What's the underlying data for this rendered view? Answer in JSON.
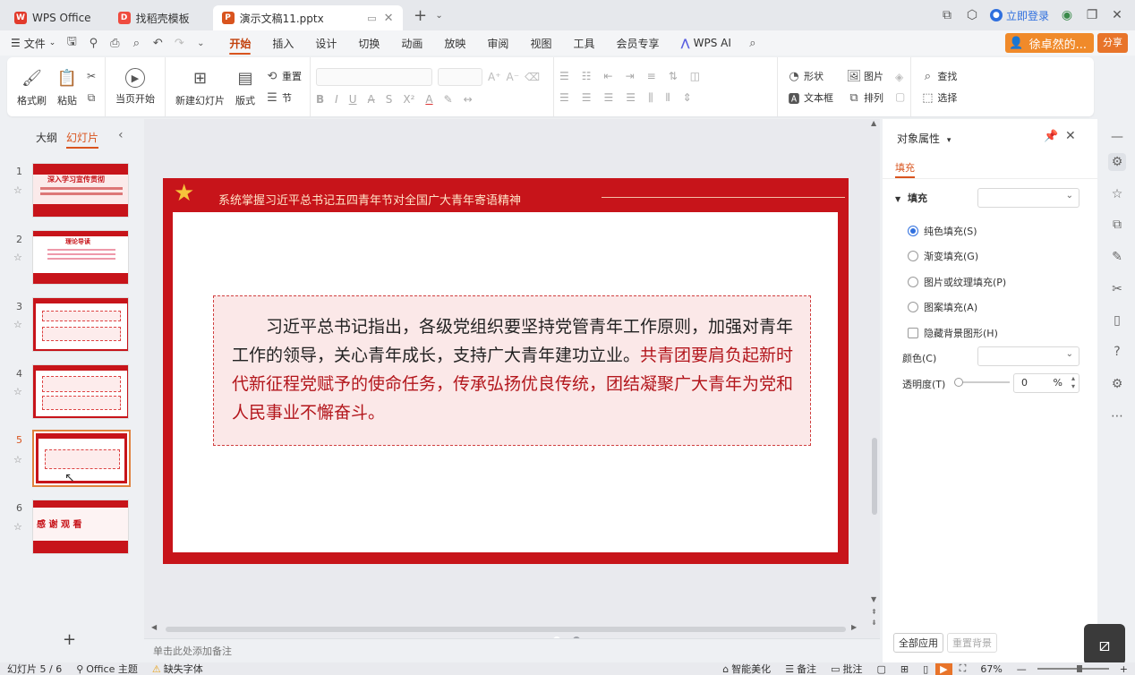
{
  "titlebar": {
    "tabs": [
      {
        "label": "WPS Office",
        "icon": "wps-logo-icon"
      },
      {
        "label": "找稻壳模板",
        "icon": "docer-icon"
      },
      {
        "label": "演示文稿11.pptx",
        "icon": "ppt-file-icon"
      }
    ],
    "login_label": "立即登录",
    "user_name": "徐卓然的..."
  },
  "menubar": {
    "file_label": "文件",
    "items": [
      "开始",
      "插入",
      "设计",
      "切换",
      "动画",
      "放映",
      "审阅",
      "视图",
      "工具",
      "会员专享"
    ],
    "active_item": "开始",
    "wps_ai_label": "WPS AI",
    "share_label": "分享"
  },
  "ribbon": {
    "format_painter": "格式刷",
    "paste": "粘贴",
    "from_current": "当页开始",
    "new_slide": "新建幻灯片",
    "layout": "版式",
    "reset": "重置",
    "section": "节",
    "shape": "形状",
    "picture": "图片",
    "textbox": "文本框",
    "arrange": "排列",
    "find": "查找",
    "select": "选择"
  },
  "leftpane": {
    "tab_outline": "大纲",
    "tab_slides": "幻灯片",
    "numbers": [
      "1",
      "2",
      "3",
      "4",
      "5",
      "6"
    ],
    "selected_index": 5,
    "thumb1_title": "深入学习宣传贯彻",
    "thumb2_title": "理论导读",
    "thumb6_title": "感 谢 观 看"
  },
  "slide": {
    "header_title": "系统掌握习近平总书记五四青年节对全国广大青年寄语精神",
    "body_black": "习近平总书记指出，各级党组织要坚持党管青年工作原则，加强对青年工作的领导，关心青年成长，支持广大青年建功立业。",
    "body_red": "共青团要肩负起新时代新征程党赋予的使命任务，传承弘扬优良传统，团结凝聚广大青年为党和人民事业不懈奋斗。"
  },
  "notes_placeholder": "单击此处添加备注",
  "rightpane": {
    "title": "对象属性",
    "tab_fill": "填充",
    "section_fill": "填充",
    "options": [
      "纯色填充(S)",
      "渐变填充(G)",
      "图片或纹理填充(P)",
      "图案填充(A)"
    ],
    "selected_option": "纯色填充(S)",
    "hide_bg_label": "隐藏背景图形(H)",
    "color_label": "颜色(C)",
    "transparency_label": "透明度(T)",
    "transparency_value": "0",
    "transparency_unit": "%",
    "apply_all": "全部应用",
    "reset_bg": "重置背景"
  },
  "statusbar": {
    "slide_info": "幻灯片 5 / 6",
    "theme": "Office 主题",
    "missing_font": "缺失字体",
    "smart_beautify": "智能美化",
    "notes": "备注",
    "comments": "批注",
    "zoom": "67%"
  },
  "colors": {
    "accent": "#d9541e",
    "slide_red": "#c7141a",
    "text_red": "#b3161c"
  }
}
